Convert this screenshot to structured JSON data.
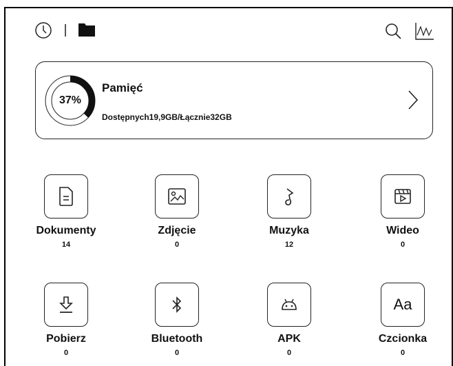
{
  "topbar": {
    "icons": [
      "clock-icon",
      "folder-icon",
      "search-icon",
      "line-chart-icon"
    ]
  },
  "storage": {
    "title": "Pamięć",
    "percent_label": "37%",
    "percent_used": 0.37,
    "detail": "Dostępnych19,9GB/Łącznie32GB"
  },
  "categories": [
    {
      "label": "Dokumenty",
      "count": "14",
      "icon": "document-icon"
    },
    {
      "label": "Zdjęcie",
      "count": "0",
      "icon": "image-icon"
    },
    {
      "label": "Muzyka",
      "count": "12",
      "icon": "music-note-icon"
    },
    {
      "label": "Wideo",
      "count": "0",
      "icon": "video-icon"
    },
    {
      "label": "Pobierz",
      "count": "0",
      "icon": "download-icon"
    },
    {
      "label": "Bluetooth",
      "count": "0",
      "icon": "bluetooth-icon"
    },
    {
      "label": "APK",
      "count": "0",
      "icon": "android-icon"
    },
    {
      "label": "Czcionka",
      "count": "0",
      "icon": "font-icon"
    }
  ],
  "font_tile_glyph": "Aa"
}
